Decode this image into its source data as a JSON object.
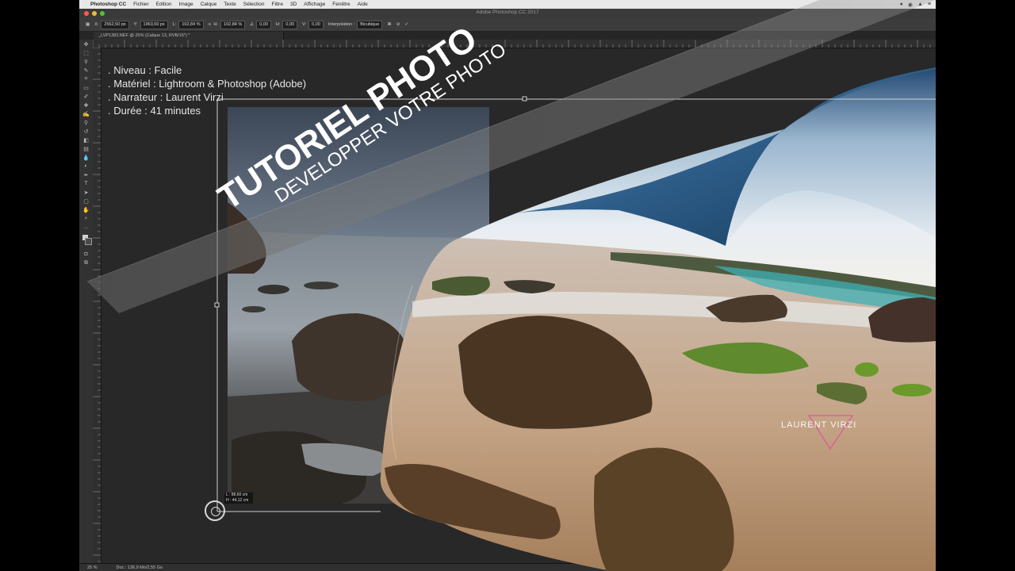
{
  "menubar": {
    "apple": "",
    "items": [
      "Photoshop CC",
      "Fichier",
      "Edition",
      "Image",
      "Calque",
      "Texte",
      "Sélection",
      "Filtre",
      "3D",
      "Affichage",
      "Fenêtre",
      "Aide"
    ]
  },
  "window": {
    "title": "Adobe Photoshop CC 2017"
  },
  "options": {
    "x": "2562,50 px",
    "y": "1963,50 px",
    "w": "102,84 %",
    "h": "102,84 %",
    "angle": "0,00",
    "hskew": "0,00",
    "vskew": "0,00",
    "interp_label": "Interpolation :",
    "interp_value": "Bicubique"
  },
  "document": {
    "tab": "_LVP1383.NEF @ 25% (Calque 13, RVB/16*) *"
  },
  "overlay": {
    "niveau": ". Niveau : Facile",
    "materiel": ". Matériel : Lightroom & Photoshop (Adobe)",
    "narrateur": ". Narrateur : Laurent Virzi",
    "duree": ". Durée : 41 minutes"
  },
  "banner": {
    "title": "TUTORIEL PHOTO",
    "subtitle": "DEVELOPPER VOTRE PHOTO"
  },
  "transform_tip": {
    "l": "L : 88,60 cm",
    "h": "H : 44,12 cm"
  },
  "watermark": "LAURENT VIRZI",
  "status": {
    "zoom": "25 %",
    "doc": "Doc : 136,9 Mo/2,55 Go"
  },
  "colors": {
    "accent": "#3aa0d8",
    "background": "#262626"
  }
}
